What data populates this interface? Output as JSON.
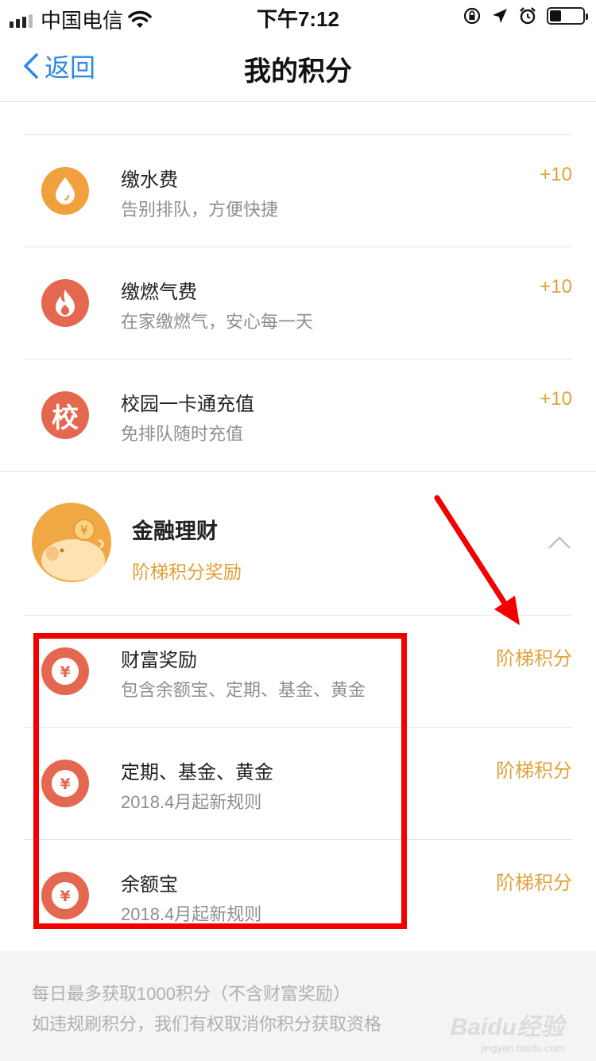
{
  "status_bar": {
    "carrier": "中国电信",
    "time": "下午7:12",
    "battery_level": 0.35
  },
  "nav": {
    "back_label": "返回",
    "title": "我的积分"
  },
  "utility_items": [
    {
      "title": "缴水费",
      "subtitle": "告别排队，方便快捷",
      "points": "+10",
      "icon": "water-drop-icon",
      "color": "#f0a03c"
    },
    {
      "title": "缴燃气费",
      "subtitle": "在家缴燃气，安心每一天",
      "points": "+10",
      "icon": "flame-icon",
      "color": "#e4674f"
    },
    {
      "title": "校园一卡通充值",
      "subtitle": "免排队随时充值",
      "points": "+10",
      "icon": "campus-icon",
      "icon_text": "校",
      "color": "#e4674f"
    }
  ],
  "finance": {
    "title": "金融理财",
    "subtitle": "阶梯积分奖励",
    "icon": "piggy-bank-icon",
    "pig_coin": "¥",
    "items": [
      {
        "title": "财富奖励",
        "subtitle": "包含余额宝、定期、基金、黄金",
        "action": "阶梯积分",
        "icon": "yuan-coin-icon",
        "coin": "¥"
      },
      {
        "title": "定期、基金、黄金",
        "subtitle": "2018.4月起新规则",
        "action": "阶梯积分",
        "icon": "yuan-coin-icon",
        "coin": "¥"
      },
      {
        "title": "余额宝",
        "subtitle": "2018.4月起新规则",
        "action": "阶梯积分",
        "icon": "yuan-coin-icon",
        "coin": "¥"
      }
    ]
  },
  "footer": {
    "line1": "每日最多获取1000积分（不含财富奖励）",
    "line2": "如违规刷积分，我们有权取消你积分获取资格"
  },
  "watermark": {
    "text": "Baidu经验",
    "url": "jingyan.baidu.com"
  },
  "colors": {
    "accent_blue": "#2f86e5",
    "points_gold": "#e3a13a",
    "highlight_red": "#f20000"
  }
}
